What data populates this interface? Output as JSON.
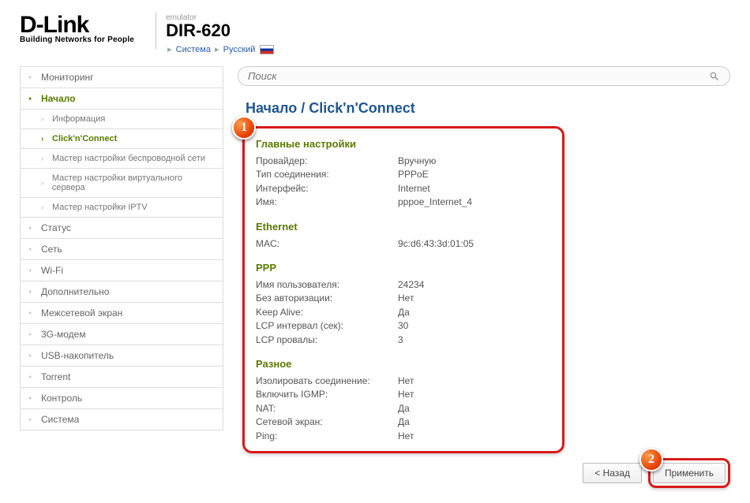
{
  "header": {
    "logo_main": "D-Link",
    "logo_sub": "Building Networks for People",
    "emu_label": "emulator",
    "model": "DIR-620",
    "sys_link": "Система",
    "lang_link": "Русский"
  },
  "search": {
    "placeholder": "Поиск"
  },
  "sidebar": {
    "items": [
      {
        "label": "Мониторинг"
      },
      {
        "label": "Начало",
        "active": true
      },
      {
        "label": "Информация",
        "sub": true
      },
      {
        "label": "Click'n'Connect",
        "sub": true,
        "active": true
      },
      {
        "label": "Мастер настройки беспроводной сети",
        "sub": true
      },
      {
        "label": "Мастер настройки виртуального сервера",
        "sub": true
      },
      {
        "label": "Мастер настройки IPTV",
        "sub": true
      },
      {
        "label": "Статус"
      },
      {
        "label": "Сеть"
      },
      {
        "label": "Wi-Fi"
      },
      {
        "label": "Дополнительно"
      },
      {
        "label": "Межсетевой экран"
      },
      {
        "label": "3G-модем"
      },
      {
        "label": "USB-накопитель"
      },
      {
        "label": "Torrent"
      },
      {
        "label": "Контроль"
      },
      {
        "label": "Система"
      }
    ]
  },
  "breadcrumb": "Начало /  Click'n'Connect",
  "sections": {
    "main": {
      "title": "Главные настройки",
      "rows": [
        {
          "label": "Провайдер:",
          "val": "Вручную"
        },
        {
          "label": "Тип соединения:",
          "val": "PPPoE"
        },
        {
          "label": "Интерфейс:",
          "val": "Internet"
        },
        {
          "label": "Имя:",
          "val": "pppoe_Internet_4"
        }
      ]
    },
    "eth": {
      "title": "Ethernet",
      "rows": [
        {
          "label": "MAC:",
          "val": "9c:d6:43:3d:01:05"
        }
      ]
    },
    "ppp": {
      "title": "PPP",
      "rows": [
        {
          "label": "Имя пользователя:",
          "val": "24234"
        },
        {
          "label": "Без авторизации:",
          "val": "Нет"
        },
        {
          "label": "Keep Alive:",
          "val": "Да"
        },
        {
          "label": "LCP интервал (сек):",
          "val": "30"
        },
        {
          "label": "LCP провалы:",
          "val": "3"
        }
      ]
    },
    "misc": {
      "title": "Разное",
      "rows": [
        {
          "label": "Изолировать соединение:",
          "val": "Нет"
        },
        {
          "label": "Включить IGMP:",
          "val": "Нет"
        },
        {
          "label": "NAT:",
          "val": "Да"
        },
        {
          "label": "Сетевой экран:",
          "val": "Да"
        },
        {
          "label": "Ping:",
          "val": "Нет"
        }
      ]
    }
  },
  "buttons": {
    "back": "< Назад",
    "apply": "Применить"
  },
  "callouts": {
    "one": "1",
    "two": "2"
  }
}
